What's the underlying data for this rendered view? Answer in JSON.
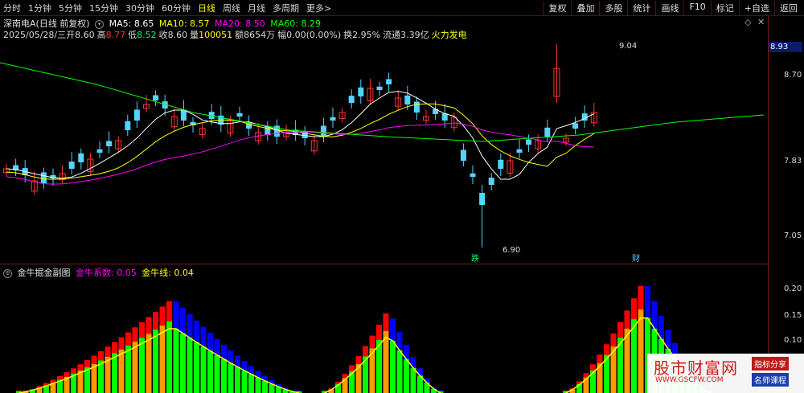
{
  "toolbar": {
    "periods": [
      "分时",
      "1分钟",
      "5分钟",
      "15分钟",
      "30分钟",
      "60分钟",
      "日线",
      "周线",
      "月线",
      "多周期",
      "更多>"
    ],
    "active_period": "日线",
    "right_buttons": [
      "复权",
      "叠加",
      "多股",
      "统计",
      "画线",
      "F10",
      "标记",
      "+自选",
      "返回"
    ]
  },
  "chart_header": {
    "title": "深南电A(日线 前复权)",
    "ma5": "MA5: 8.65",
    "ma10": "MA10: 8.57",
    "ma20": "MA20: 8.50",
    "ma60": "MA60: 8.29",
    "icons": [
      "diamond-icon",
      "close-icon"
    ]
  },
  "quote_line": {
    "date": "2025/05/28/三",
    "open_label": "开",
    "open": "8.60",
    "high_label": "高",
    "high": "8.77",
    "low_label": "低",
    "low": "8.52",
    "close_label": "收",
    "close": "8.60",
    "volume_label": "量",
    "volume": "100051",
    "amount_label": "额",
    "amount": "8654万",
    "change_label": "幅",
    "change": "0.00(0.00%)",
    "turnover_label": "换",
    "turnover": "2.95%",
    "float_label": "流通",
    "float_value": "3.39亿",
    "concept": "火力发电"
  },
  "price_axis": {
    "current": "8.93",
    "ticks": [
      "8.70",
      "7.83",
      "7.05"
    ]
  },
  "annotations": {
    "high_mark": "9.04",
    "low_mark": "6.90",
    "drop_label": "跌",
    "wealth_label": "财"
  },
  "sub_chart": {
    "title": "金牛掘金副图",
    "coef": "金牛系数: 0.05",
    "line": "金牛线: 0.04",
    "ticks": [
      "0.20",
      "0.15",
      "0.10"
    ]
  },
  "watermark": {
    "title": "股市财富网",
    "url": "WWW.GSCFW.COM",
    "badge1": "指标分享",
    "badge2": "名师课程"
  },
  "colors": {
    "up": "#ff3232",
    "down": "#54d4ff",
    "ma5": "#ffffff",
    "ma10": "#ffff00",
    "ma20": "#ff00ff",
    "ma60": "#00ff00",
    "bar_red": "#ff0000",
    "bar_blue": "#0000ff",
    "bar_orange": "#ff9900",
    "bar_green": "#00ff00"
  }
}
